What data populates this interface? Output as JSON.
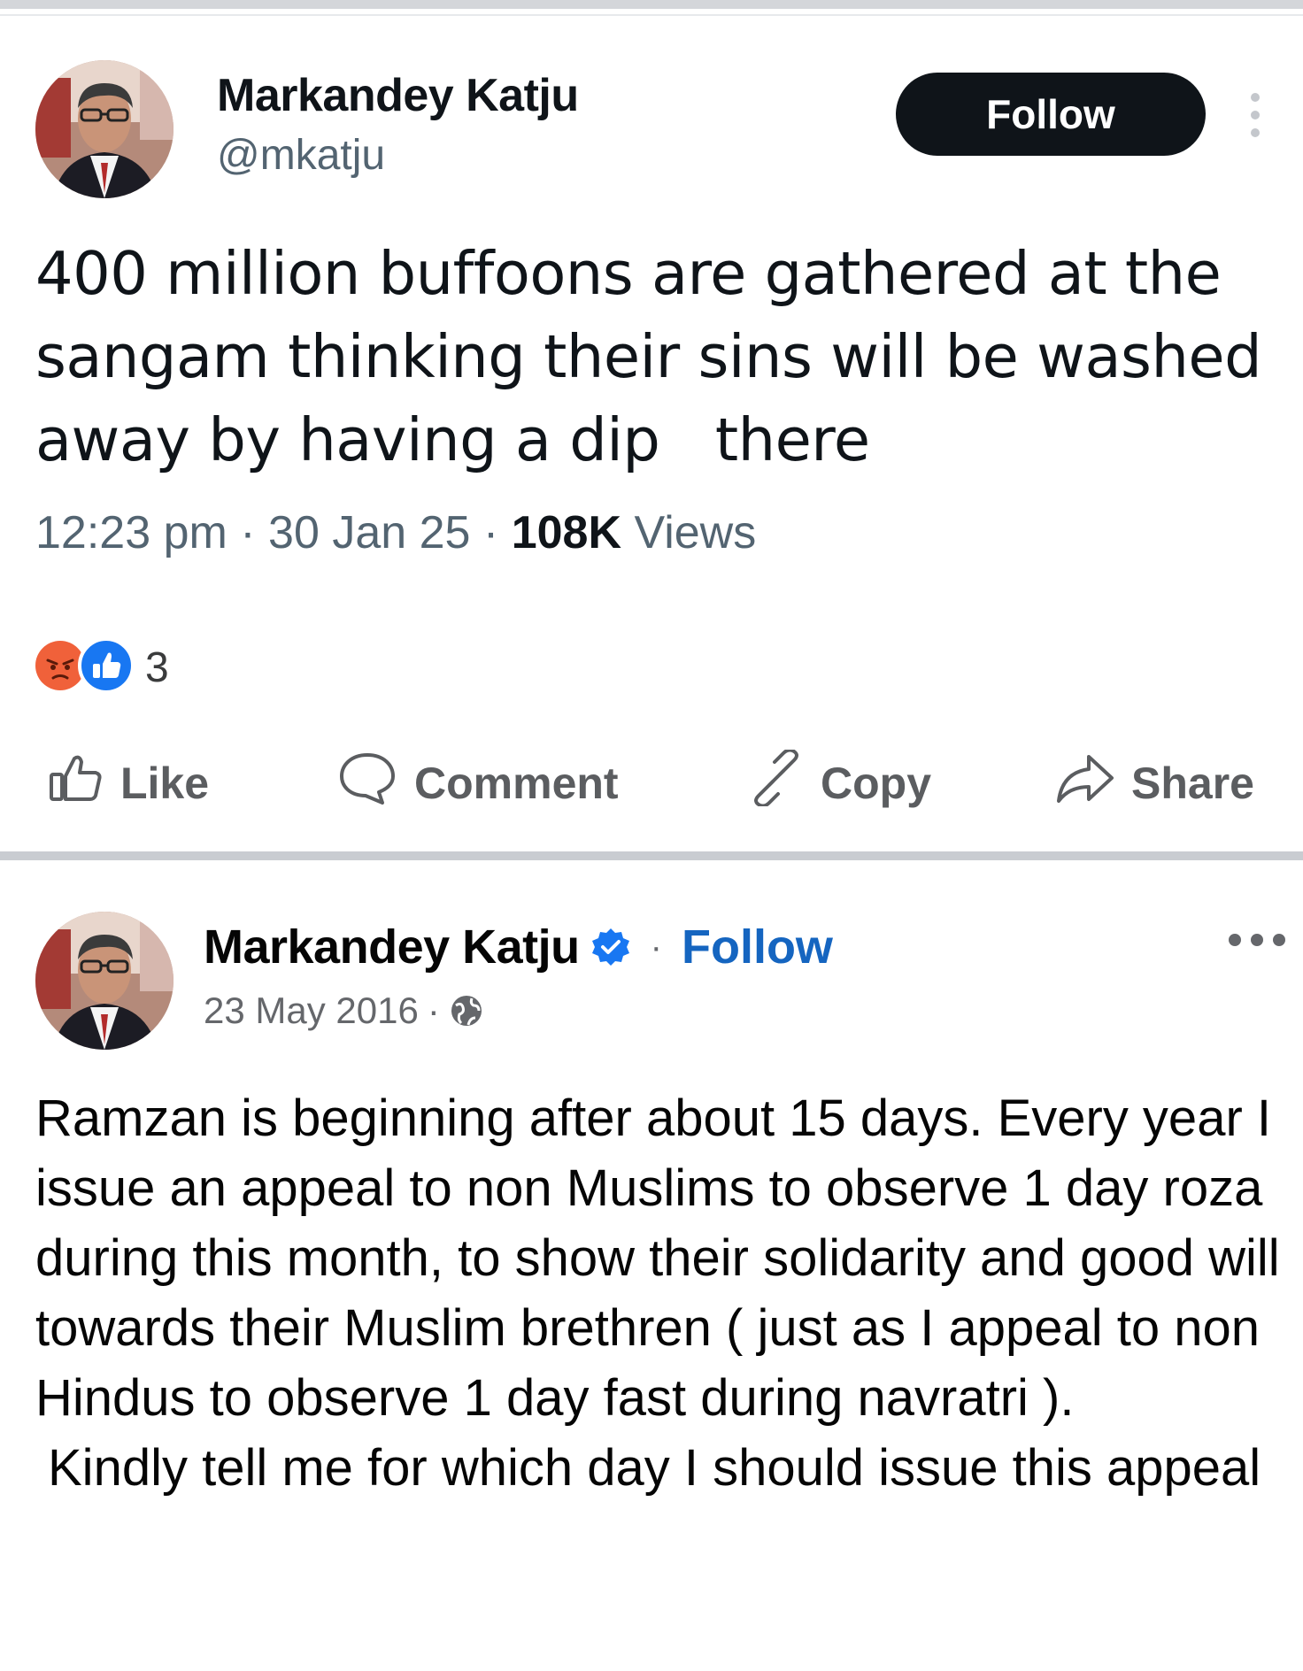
{
  "post1": {
    "author_name": "Markandey Katju",
    "handle": "@mkatju",
    "follow_label": "Follow",
    "text": "400 million buffoons are gathered at the sangam thinking their sins will be washed away by having a dip   there",
    "time": "12:23 pm",
    "date": "30 Jan 25",
    "separator": "·",
    "views_count": "108K",
    "views_label": "Views",
    "reaction_count": "3",
    "actions": {
      "like": "Like",
      "comment": "Comment",
      "copy": "Copy",
      "share": "Share"
    }
  },
  "post2": {
    "author_name": "Markandey Katju",
    "separator": "·",
    "follow_label": "Follow",
    "date": "23 May 2016",
    "paragraph1": "Ramzan is beginning after about 15 days. Every year I issue an appeal to non Muslims to observe 1 day roza during this month, to show their solidarity and good will towards their Muslim brethren ( just as I appeal to non Hindus to observe 1 day fast during navratri ).",
    "paragraph2": "Kindly tell me for which day I should issue this appeal"
  },
  "colors": {
    "x_follow_bg": "#0f1419",
    "fb_follow": "#1565c0",
    "verified_badge": "#1877f2",
    "angry_reaction": "#f0613a",
    "like_reaction": "#1877f2"
  },
  "icons": [
    "more-vertical-icon",
    "angry-reaction-icon",
    "like-reaction-icon",
    "thumbs-up-icon",
    "comment-icon",
    "link-icon",
    "share-icon",
    "verified-badge-icon",
    "globe-icon",
    "more-horizontal-icon"
  ]
}
